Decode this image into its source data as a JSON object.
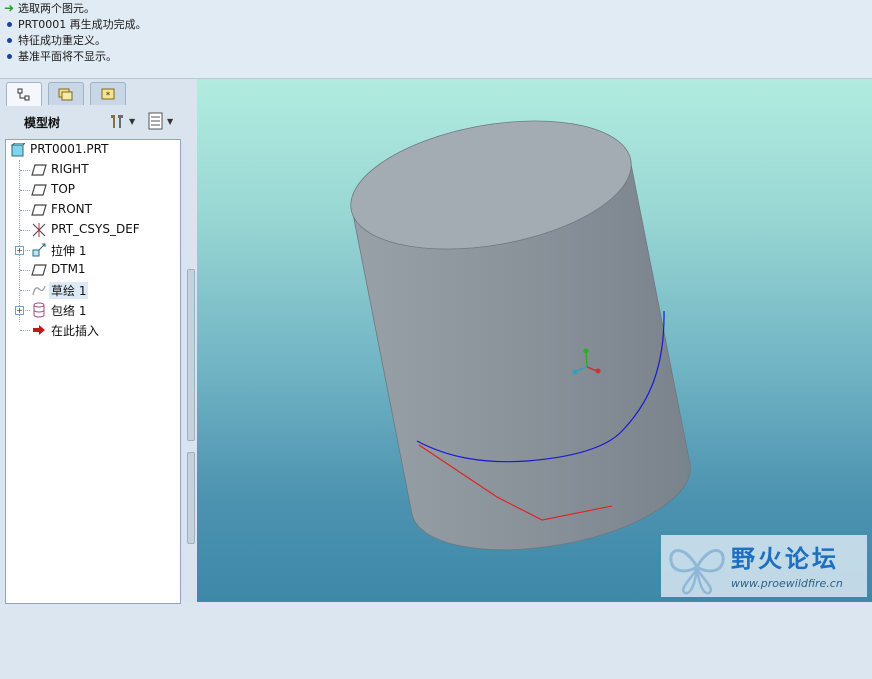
{
  "messages": [
    {
      "icon": "green-arrow-icon",
      "text": "选取两个图元。"
    },
    {
      "icon": "blue-dot-icon",
      "text": "PRT0001 再生成功完成。"
    },
    {
      "icon": "blue-dot-icon",
      "text": "特征成功重定义。"
    },
    {
      "icon": "blue-dot-icon",
      "text": "基准平面将不显示。"
    }
  ],
  "left_panel": {
    "tabs": [
      {
        "icon": "model-tree-icon",
        "active": true
      },
      {
        "icon": "folder-browser-icon",
        "active": false
      },
      {
        "icon": "favorites-icon",
        "active": false
      }
    ],
    "title": "模型树",
    "toolbar": {
      "settings_icon": "tools-icon",
      "show_icon": "list-icon"
    }
  },
  "model_tree": {
    "root": {
      "label": "PRT0001.PRT",
      "icon": "part-icon"
    },
    "items": [
      {
        "label": "RIGHT",
        "icon": "datum-plane-icon",
        "expandable": false,
        "selected": false
      },
      {
        "label": "TOP",
        "icon": "datum-plane-icon",
        "expandable": false,
        "selected": false
      },
      {
        "label": "FRONT",
        "icon": "datum-plane-icon",
        "expandable": false,
        "selected": false
      },
      {
        "label": "PRT_CSYS_DEF",
        "icon": "coordinate-system-icon",
        "expandable": false,
        "selected": false
      },
      {
        "label": "拉伸 1",
        "icon": "extrude-icon",
        "expandable": true,
        "selected": false
      },
      {
        "label": "DTM1",
        "icon": "datum-plane-icon",
        "expandable": false,
        "selected": false
      },
      {
        "label": "草绘 1",
        "icon": "sketch-icon",
        "expandable": false,
        "selected": true
      },
      {
        "label": "包络 1",
        "icon": "wrap-icon",
        "expandable": true,
        "selected": false
      },
      {
        "label": "在此插入",
        "icon": "insert-here-arrow-icon",
        "expandable": false,
        "selected": false
      }
    ]
  },
  "colors": {
    "viewport_top": "#b2ece0",
    "viewport_bottom": "#3e88a8",
    "cylinder_body": "#8a929b",
    "cylinder_top": "#a2aab2",
    "sketch_curve": "#1a1ad0",
    "wrap_curve": "#e02020"
  },
  "watermark": {
    "title": "野火论坛",
    "url": "www.proewildfire.cn",
    "logo_icon": "butterfly-logo-icon"
  }
}
